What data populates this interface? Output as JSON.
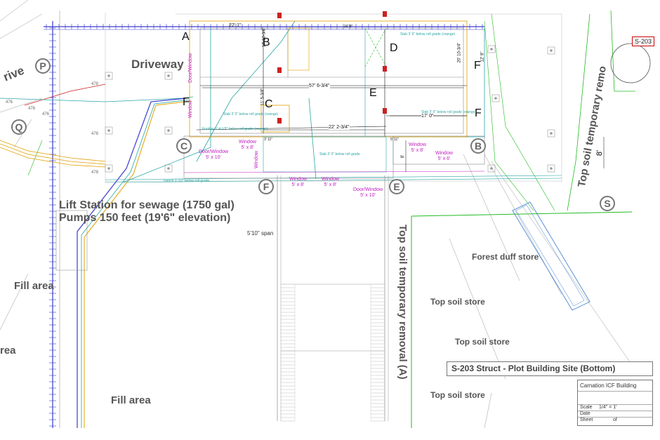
{
  "drawing": {
    "areas": {
      "driveway": "Driveway",
      "drive_partial": "rive",
      "lift_line1": "Lift Station for sewage (1750 gal)",
      "lift_line2": "Pumps 150 feet (19'6\" elevation)",
      "fill_area_1": "Fill area",
      "fill_area_2": "Fill area",
      "area_partial": "rea",
      "forest_duff": "Forest duff store",
      "top_soil_1": "Top soil store",
      "top_soil_2": "Top soil store",
      "top_soil_3": "Top soil store",
      "top_soil_removal_right": "Top soil temporary remo",
      "top_soil_removal_center": "Top soil temporary removal (A)"
    },
    "grid_letters": [
      "A",
      "B",
      "C",
      "D",
      "E",
      "F",
      "F",
      "F"
    ],
    "bubbles": [
      "P",
      "Q",
      "C",
      "B",
      "F",
      "E",
      "S"
    ],
    "dimensions": {
      "d1": "22' 1\"",
      "d2": "57' 6-3/4\"",
      "d3": "22' 2-3/4\"",
      "d4": "17' 0\"",
      "d5": "8'",
      "d6": "5'10\" span",
      "d7": "17' 10-3/8\"",
      "d8": "11' 5-3/8\"",
      "d9": "20' 10-3/4\"",
      "d10": "12' 9\"",
      "d11": "5' 11\"",
      "d12": "3' 11\"",
      "d13": "16' 8\""
    },
    "openings": [
      "Door/Window\n5' x 10'",
      "Window\n5' x 8'",
      "Window\n5' x 8'",
      "Window\n5' x 8'",
      "Door/Window\n5' x 10'",
      "Window\n5' x 8'",
      "Window\n5' x 6'",
      "Window"
    ],
    "vertical_labels": [
      "Door/Window",
      "Window"
    ],
    "elevations": [
      "478",
      "476",
      "478",
      "478",
      "476",
      "478"
    ],
    "notes": [
      "Slab 3' 6\" below roll grade (orange)",
      "Slab 3' 0\" below roll grade (orange)",
      "Slab 3' 0\" below roll grade (orange)",
      "Footing 5' 4-1/2\" below roll grade (orange)",
      "Slab 3' 0\" below roll grade",
      "Trench 1'-10\" below roll grade"
    ],
    "sheet_tag": "S-203",
    "sheet_title": "S-203 Struct - Plot Building Site (Bottom)",
    "scale_value": "8'"
  },
  "title_block": {
    "project": "Carnation ICF Building",
    "scale_label": "Scale",
    "scale_value": "1/4\"  =  1'",
    "date_label": "Date",
    "sheet_label": "Sheet",
    "sheet_of": "of"
  },
  "colors": {
    "grid": "#3a3ad0",
    "teal": "#2aa6a6",
    "green": "#22bb22",
    "orange": "#e0a000",
    "magenta": "#c020c0",
    "red": "#cc2020"
  }
}
